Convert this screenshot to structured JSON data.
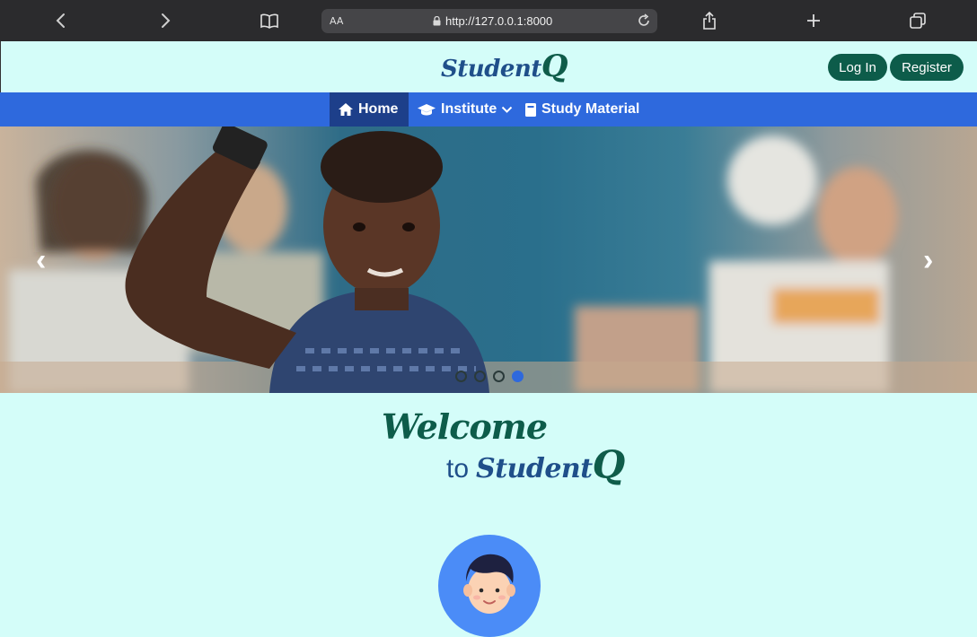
{
  "browser": {
    "text_size_label": "AA",
    "url": "http://127.0.0.1:8000"
  },
  "header": {
    "logo_text": "Student",
    "logo_q": "Q",
    "login_label": "Log In",
    "register_label": "Register"
  },
  "nav": {
    "items": [
      {
        "label": "Home",
        "icon": "home-icon"
      },
      {
        "label": "Institute",
        "icon": "graduation-cap-icon"
      },
      {
        "label": "Study Material",
        "icon": "book-icon"
      }
    ]
  },
  "carousel": {
    "prev_symbol": "‹",
    "next_symbol": "›",
    "slide_count": 4,
    "active_slide": 4
  },
  "welcome": {
    "line1": "Welcome",
    "line2_to": "to",
    "line2_brand": "Student",
    "line2_q": "Q"
  },
  "colors": {
    "page_bg": "#d4fdf9",
    "nav_bg": "#2e69dd",
    "nav_active_bg": "#1d3f8a",
    "button_bg": "#0d5c4a",
    "brand_blue": "#1f4f8a",
    "brand_green": "#0d5c4a"
  }
}
